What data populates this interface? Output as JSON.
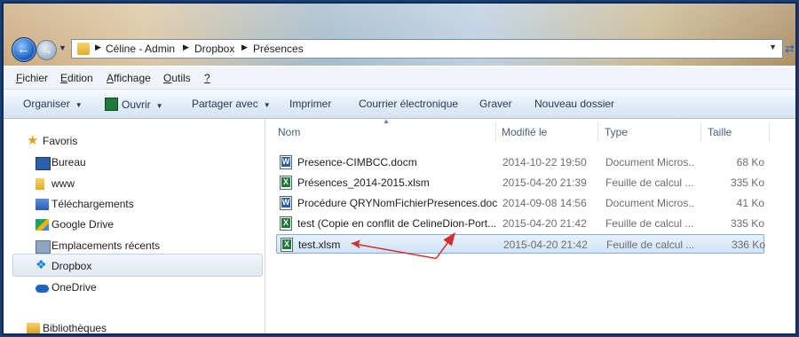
{
  "address_bar": {
    "segments": [
      "Céline - Admin",
      "Dropbox",
      "Présences"
    ]
  },
  "menu": {
    "items": [
      {
        "prefix": "",
        "u": "F",
        "rest": "ichier"
      },
      {
        "prefix": "",
        "u": "E",
        "rest": "dition"
      },
      {
        "prefix": "",
        "u": "A",
        "rest": "ffichage"
      },
      {
        "prefix": "",
        "u": "O",
        "rest": "utils"
      },
      {
        "prefix": "",
        "u": "?",
        "rest": ""
      }
    ]
  },
  "toolbar": {
    "organiser": "Organiser",
    "ouvrir": "Ouvrir",
    "partager": "Partager avec",
    "imprimer": "Imprimer",
    "courrier": "Courrier électronique",
    "graver": "Graver",
    "nouveau_dossier": "Nouveau dossier"
  },
  "navigation": {
    "favoris": "Favoris",
    "items": [
      "Bureau",
      "www",
      "Téléchargements",
      "Google Drive",
      "Emplacements récents",
      "Dropbox",
      "OneDrive"
    ],
    "bibliotheques": "Bibliothèques",
    "selected": "Dropbox"
  },
  "file_list": {
    "columns": {
      "name": "Nom",
      "modified": "Modifié le",
      "type": "Type",
      "size": "Taille"
    },
    "files": [
      {
        "name": "Presence-CIMBCC.docm",
        "modified": "2014-10-22 19:50",
        "type": "Document Micros...",
        "size": "68 Ko",
        "kind": "word"
      },
      {
        "name": "Présences_2014-2015.xlsm",
        "modified": "2015-04-20 21:39",
        "type": "Feuille de calcul ...",
        "size": "335 Ko",
        "kind": "excel"
      },
      {
        "name": "Procédure QRYNomFichierPresences.doc",
        "modified": "2014-09-08 14:56",
        "type": "Document Micros...",
        "size": "41 Ko",
        "kind": "word"
      },
      {
        "name": "test (Copie en conflit de CelineDion-Port...",
        "modified": "2015-04-20 21:42",
        "type": "Feuille de calcul ...",
        "size": "335 Ko",
        "kind": "excel"
      },
      {
        "name": "test.xlsm",
        "modified": "2015-04-20 21:42",
        "type": "Feuille de calcul ...",
        "size": "336 Ko",
        "kind": "excel"
      }
    ],
    "selected_index": 4
  },
  "annotation": {
    "color": "#d62d2d"
  }
}
